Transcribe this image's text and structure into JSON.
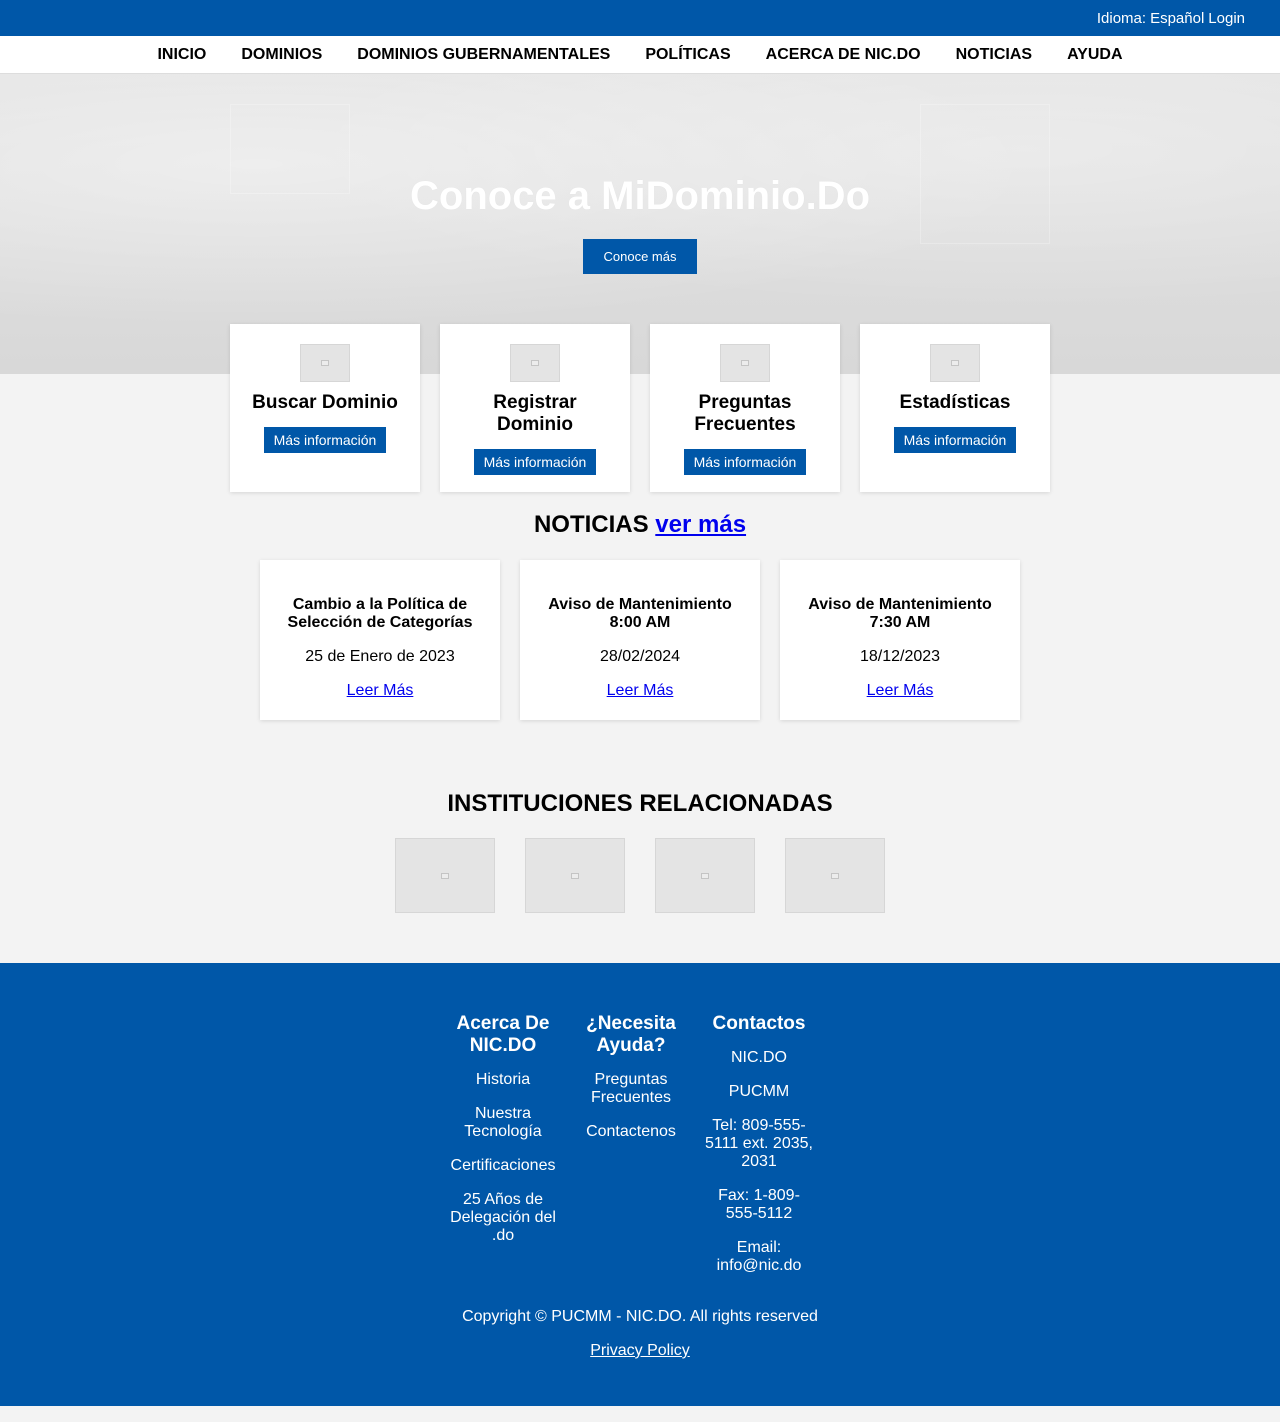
{
  "topbar": {
    "language_label": "Idioma:",
    "language_value": "Español",
    "login_label": "Login"
  },
  "nav": {
    "items": [
      "INICIO",
      "DOMINIOS",
      "DOMINIOS GUBERNAMENTALES",
      "POLÍTICAS",
      "ACERCA DE NIC.DO",
      "NOTICIAS",
      "AYUDA"
    ]
  },
  "hero": {
    "title": "Conoce a MiDominio.Do",
    "button_label": "Conoce más"
  },
  "features": [
    {
      "title": "Buscar Dominio",
      "button": "Más información"
    },
    {
      "title": "Registrar Dominio",
      "button": "Más información"
    },
    {
      "title": "Preguntas Frecuentes",
      "button": "Más información"
    },
    {
      "title": "Estadísticas",
      "button": "Más información"
    }
  ],
  "news": {
    "heading": "NOTICIAS",
    "more_link": "ver más",
    "items": [
      {
        "title": "Cambio a la Política de Selección de Categorías",
        "date": "25 de Enero de 2023",
        "link": "Leer Más"
      },
      {
        "title": "Aviso de Mantenimiento 8:00 AM",
        "date": "28/02/2024",
        "link": "Leer Más"
      },
      {
        "title": "Aviso de Mantenimiento 7:30 AM",
        "date": "18/12/2023",
        "link": "Leer Más"
      }
    ]
  },
  "institutions": {
    "heading": "INSTITUCIONES RELACIONADAS",
    "logo_count": 4
  },
  "footer": {
    "about": {
      "heading": "Acerca De NIC.DO",
      "links": [
        "Historia",
        "Nuestra Tecnología",
        "Certificaciones",
        "25 Años de Delegación del .do"
      ]
    },
    "help": {
      "heading": "¿Necesita Ayuda?",
      "links": [
        "Preguntas Frecuentes",
        "Contactenos"
      ]
    },
    "contacts": {
      "heading": "Contactos",
      "lines": [
        "NIC.DO",
        "PUCMM",
        "Tel: 809-555-5111 ext. 2035, 2031",
        "Fax: 1-809-555-5112",
        "Email: info@nic.do"
      ]
    },
    "copyright": "Copyright © PUCMM - NIC.DO. All rights reserved",
    "privacy": "Privacy Policy"
  },
  "colors": {
    "brand_blue": "#0057a8",
    "link_blue": "#0000ee",
    "page_bg": "#f3f3f3"
  }
}
